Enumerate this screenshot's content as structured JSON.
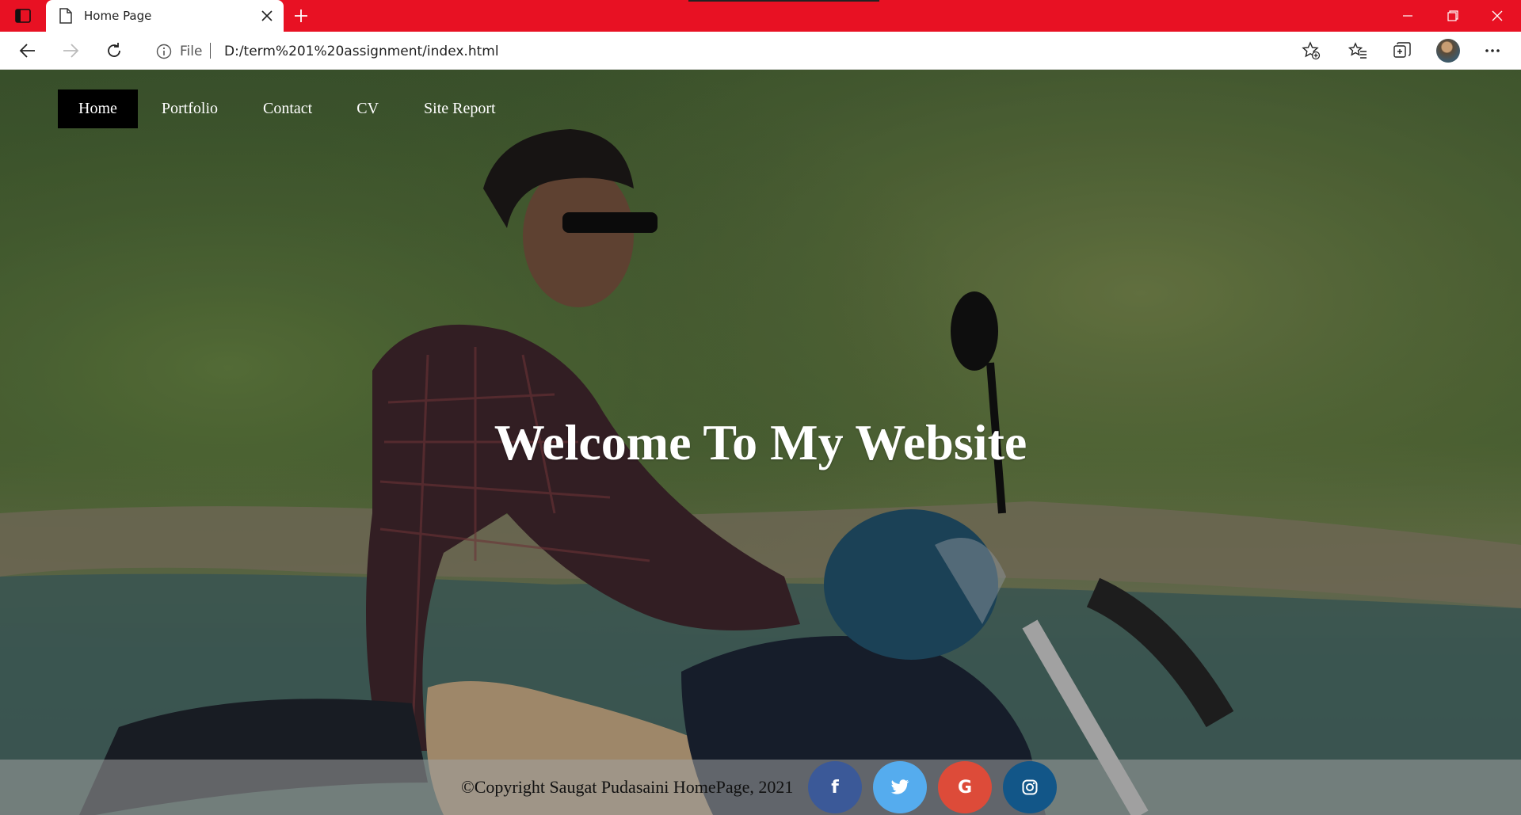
{
  "browser": {
    "tab_title": "Home Page",
    "address_scheme": "File",
    "address_url": "D:/term%201%20assignment/index.html"
  },
  "nav": {
    "items": [
      {
        "label": "Home",
        "active": true
      },
      {
        "label": "Portfolio",
        "active": false
      },
      {
        "label": "Contact",
        "active": false
      },
      {
        "label": "CV",
        "active": false
      },
      {
        "label": "Site Report",
        "active": false
      }
    ]
  },
  "hero": {
    "title": "Welcome To My Website"
  },
  "footer": {
    "copyright": "©Copyright Saugat Pudasaini HomePage, 2021",
    "social": [
      {
        "name": "facebook-icon",
        "glyph": "f",
        "color": "#3b5998"
      },
      {
        "name": "twitter-icon",
        "glyph": "",
        "color": "#55acee"
      },
      {
        "name": "google-icon",
        "glyph": "G",
        "color": "#dd4b39"
      },
      {
        "name": "instagram-icon",
        "glyph": "",
        "color": "#125688"
      }
    ]
  },
  "colors": {
    "titlebar": "#e81123",
    "nav_active_bg": "#000000",
    "hero_text": "#ffffff"
  }
}
